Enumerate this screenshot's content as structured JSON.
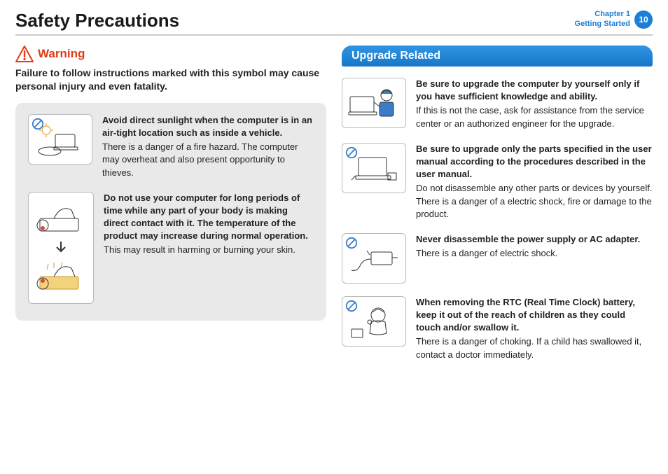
{
  "header": {
    "title": "Safety Precautions",
    "chapter_line1": "Chapter 1",
    "chapter_line2": "Getting Started",
    "page_number": "10"
  },
  "warning": {
    "label": "Warning",
    "description": "Failure to follow instructions marked with this symbol may cause personal injury and even fatality."
  },
  "left_items": [
    {
      "bold": "Avoid direct sunlight when the computer is in an air-tight location such as inside a vehicle.",
      "body": "There is a danger of a fire hazard. The computer may overheat and also present opportunity to thieves."
    },
    {
      "bold": "Do not use your computer for long periods of time while any part of your body is making direct contact with it. The temperature of the product may increase during normal operation.",
      "body": "This may result in harming or burning your skin."
    }
  ],
  "right_section": {
    "title": "Upgrade Related",
    "items": [
      {
        "bold": "Be sure to upgrade the computer by yourself only if you have sufficient knowledge and ability.",
        "body": "If this is not the case, ask for assistance from the service center or an authorized engineer for the upgrade."
      },
      {
        "bold": "Be sure to upgrade only the parts specified in the user manual according to the procedures described in the user manual.",
        "body": "Do not disassemble any other parts or devices by yourself. There is a danger of a electric shock, fire or damage to the product."
      },
      {
        "bold": "Never disassemble the power supply or AC adapter.",
        "body": "There is a danger of electric shock."
      },
      {
        "bold": "When removing the RTC (Real Time Clock) battery, keep it out of the reach of children as they could touch and/or swallow it.",
        "body": "There is a danger of choking. If a child has swallowed it, contact a doctor immediately."
      }
    ]
  }
}
